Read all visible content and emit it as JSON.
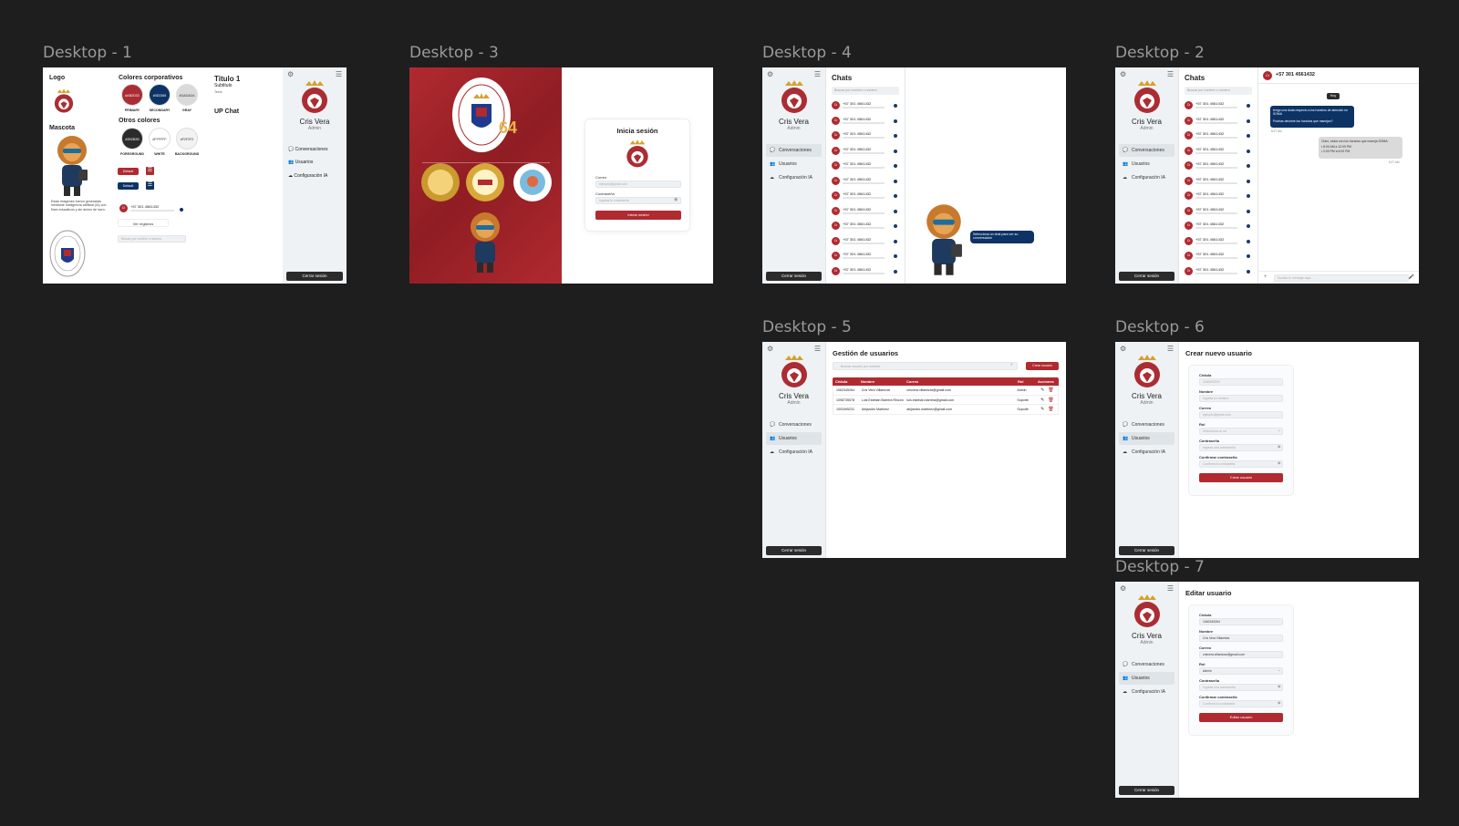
{
  "frames": {
    "d1": "Desktop - 1",
    "d3": "Desktop - 3",
    "d4": "Desktop - 4",
    "d2": "Desktop - 2",
    "d5": "Desktop - 5",
    "d6": "Desktop - 6",
    "d7": "Desktop - 7"
  },
  "sidebar": {
    "user_name": "Cris Vera",
    "user_role": "Admin",
    "nav": [
      "Conversaciones",
      "Usuarios",
      "Configuración IA"
    ],
    "logout": "Cerrar sesión"
  },
  "styleguide": {
    "logo": "Logo",
    "mascota": "Mascota",
    "colores_corp": "Colores corporativos",
    "otros_colores": "Otros colores",
    "corp_colors": [
      {
        "hex": "#AB2D33",
        "label": "PRIMARY",
        "color": "#ab2d33"
      },
      {
        "hex": "#0D3365",
        "label": "SECONDARY",
        "color": "#0d3365"
      },
      {
        "hex": "#DADADA",
        "label": "GRAY",
        "color": "#dadada"
      }
    ],
    "other_colors": [
      {
        "hex": "#2B2B2B",
        "label": "FOREGROUND",
        "color": "#2b2b2b"
      },
      {
        "hex": "#FFFFFF",
        "label": "WHITE",
        "color": "#ffffff"
      },
      {
        "hex": "#F2F2F2",
        "label": "BACKGROUND",
        "color": "#f2f2f2"
      }
    ],
    "titulo": "Titulo 1",
    "subtitulo": "Subtitulo",
    "texto": "Texto",
    "up_chat": "UP Chat",
    "btn_default": "Default",
    "disclaimer": "Estas imágenes fueron generadas mediante inteligencia artificial (IA) con fines educativos y sin ánimo de lucro.",
    "ver_registros": "Ver registros",
    "search_placeholder": "Buscar por nombre o número"
  },
  "login": {
    "title": "Inicia sesión",
    "correo_label": "Correo",
    "correo_placeholder": "ejemplo@gmail.com",
    "password_label": "Contraseña",
    "password_placeholder": "Ingresa tu contraseña",
    "submit": "Iniciar sesión",
    "university": "UNIVERSIDAD DE PAMPLONA",
    "country": "COLOMBIA",
    "years": "64"
  },
  "chats": {
    "title": "Chats",
    "search_placeholder": "Buscar por nombre o número",
    "avatar": "Cr",
    "number": "+57 301 4561432",
    "select_prompt": "Selecciona un chat para ver su conversación"
  },
  "conversation": {
    "contact": "+57 301 4561432",
    "day": "Hoy",
    "msg_in": "tengo una duda respecto a los horarios de atención en SOMA",
    "msg_in2": "Podrías decirme los horarios que manejan?",
    "time_in": "8:27 AM",
    "msg_out": "Claro, estos son los horarios que maneja SOMA:",
    "msg_out_l1": "• 8:00 AM a 12:00 PM",
    "msg_out_l2": "• 2:00 PM a 6:00 PM",
    "time_out": "8:27 AM",
    "input_placeholder": "Escribe tu mensaje aquí..."
  },
  "users": {
    "title": "Gestión de usuarios",
    "search_placeholder": "Buscar usuario por nombre",
    "create_btn": "Crear usuario",
    "headers": [
      "Cédula",
      "Nombre",
      "Correo",
      "Rol",
      "Acciones"
    ],
    "rows": [
      [
        "1062345264",
        "Cris Vera Villamizar",
        "crisvera.villamizar@gmail.com",
        "Admin"
      ],
      [
        "1098735578",
        "Luis Esteban Barrera Rincón",
        "luis.esteban.barrera@gmail.com",
        "Soporte"
      ],
      [
        "1003495231",
        "Alejandro Martínez",
        "alejandro.martinez@gmail.com",
        "Soporte"
      ]
    ]
  },
  "create_user": {
    "title": "Crear nuevo usuario",
    "fields": [
      {
        "label": "Cédula",
        "value": "1000000000"
      },
      {
        "label": "Nombre",
        "value": "Ingresa un nombre"
      },
      {
        "label": "Correo",
        "value": "ejemplo@gmail.com"
      },
      {
        "label": "Rol",
        "value": "Selecciona un rol"
      },
      {
        "label": "Contraseña",
        "value": "Ingresa una contraseña"
      },
      {
        "label": "Confirmar contraseña",
        "value": "Confirma tu contraseña"
      }
    ],
    "submit": "Crear usuario"
  },
  "edit_user": {
    "title": "Editar usuario",
    "fields": [
      {
        "label": "Cédula",
        "value": "1062345264"
      },
      {
        "label": "Nombre",
        "value": "Cris Vera Villamizar"
      },
      {
        "label": "Correo",
        "value": "crisvera.villamizar@gmail.com"
      },
      {
        "label": "Rol",
        "value": "Admin"
      },
      {
        "label": "Contraseña",
        "value": "Ingresa una contraseña"
      },
      {
        "label": "Confirmar contraseña",
        "value": "Confirma tu contraseña"
      }
    ],
    "submit": "Editar usuario"
  },
  "colors": {
    "primary": "#ab2d33",
    "secondary": "#0d3365",
    "foreground": "#2b2b2b",
    "canvas": "#1e1e1e"
  }
}
